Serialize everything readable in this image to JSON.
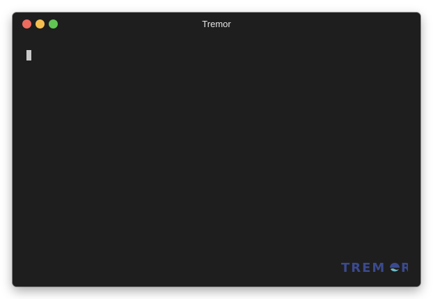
{
  "window": {
    "title": "Tremor",
    "controls": {
      "close_color": "#ed6a5e",
      "minimize_color": "#f5bf4f",
      "zoom_color": "#61c554"
    }
  },
  "terminal": {
    "background": "#1e1e1e",
    "cursor_color": "#c9c9c9",
    "content": ""
  },
  "watermark": {
    "text": "TREMOR",
    "color": "#3b4a8f",
    "accent_color": "#6fb8c6"
  }
}
